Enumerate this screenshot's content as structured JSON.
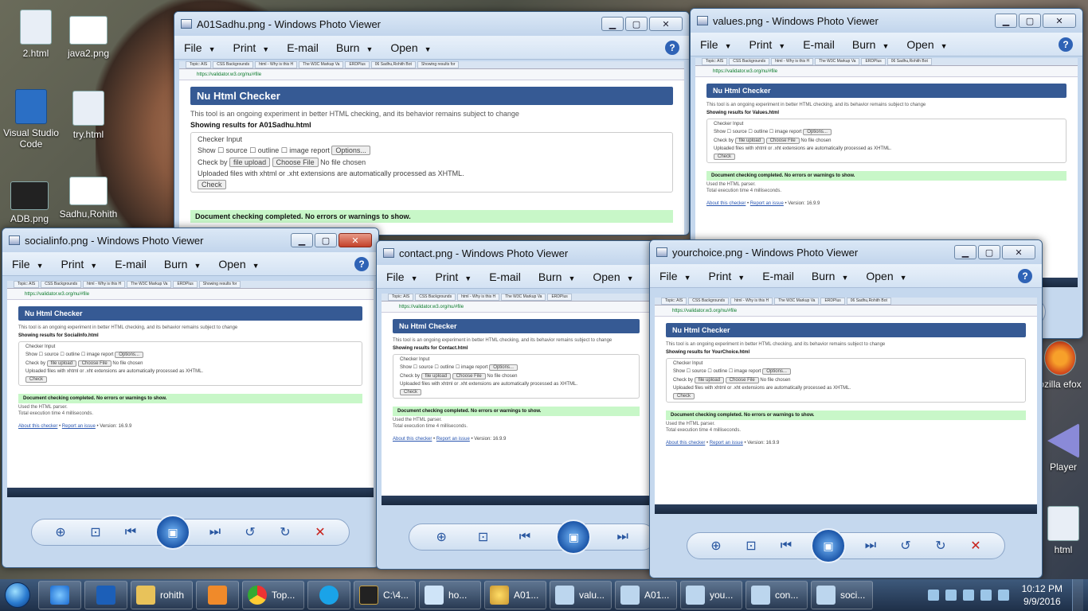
{
  "desktop": {
    "icons": [
      {
        "label": "2.html"
      },
      {
        "label": "java2.png"
      },
      {
        "label": "Visual Studio Code"
      },
      {
        "label": "try.html"
      },
      {
        "label": "ADB.png"
      },
      {
        "label": "Sadhu,Rohith"
      },
      {
        "label": "ozilla efox"
      },
      {
        "label": "Player"
      },
      {
        "label": "html"
      }
    ]
  },
  "viewer_menu": {
    "file": "File",
    "print": "Print",
    "email": "E-mail",
    "burn": "Burn",
    "open": "Open",
    "help": "?"
  },
  "windows": {
    "a01": {
      "title": "A01Sadhu.png - Windows Photo Viewer",
      "results": "Showing results for A01Sadhu.html"
    },
    "values": {
      "title": "values.png - Windows Photo Viewer",
      "results": "Showing results for Values.html"
    },
    "social": {
      "title": "socialinfo.png - Windows Photo Viewer",
      "results": "Showing results for SocialInfo.html"
    },
    "contact": {
      "title": "contact.png - Windows Photo Viewer",
      "results": "Showing results for Contact.html"
    },
    "choice": {
      "title": "yourchoice.png - Windows Photo Viewer",
      "results": "Showing results for YourChoice.html"
    }
  },
  "checker": {
    "tabs": [
      "Topic: AIS",
      "CSS Backgrounds",
      "html - Why is this H",
      "The W3C Markup Va",
      "ERDPlus",
      "06 Sadhu,Rohith Bot",
      "Showing results for"
    ],
    "url": "https://validator.w3.org/nu/#file",
    "banner": "Nu Html Checker",
    "intro": "This tool is an ongoing experiment in better HTML checking, and its behavior remains subject to change",
    "legend": "Checker Input",
    "show": "Show",
    "opt_source": "source",
    "opt_outline": "outline",
    "opt_report": "image report",
    "options_btn": "Options...",
    "check_by": "Check by",
    "upload": "file upload",
    "choose": "Choose File",
    "no_file": "No file chosen",
    "note": "Uploaded files with xhtml or .xht extensions are automatically processed as XHTML.",
    "check_btn": "Check",
    "ok": "Document checking completed. No errors or warnings to show.",
    "parser": "Used the HTML parser.",
    "time": "Total execution time 4 milliseconds.",
    "about": "About this checker",
    "report": "Report an issue",
    "version": "Version: 16.9.9"
  },
  "taskbar": {
    "items": [
      {
        "label": "rohith"
      },
      {
        "label": "Top..."
      },
      {
        "label": "C:\\4..."
      },
      {
        "label": "ho..."
      },
      {
        "label": "A01..."
      },
      {
        "label": "valu..."
      },
      {
        "label": "A01..."
      },
      {
        "label": "you..."
      },
      {
        "label": "con..."
      },
      {
        "label": "soci..."
      }
    ],
    "time": "10:12 PM",
    "date": "9/9/2016"
  },
  "colors": {
    "banner": "#365a94",
    "ok_bg": "#c8f7c8",
    "close_red": "#c3412a",
    "taskbar": "#1e2f48"
  }
}
